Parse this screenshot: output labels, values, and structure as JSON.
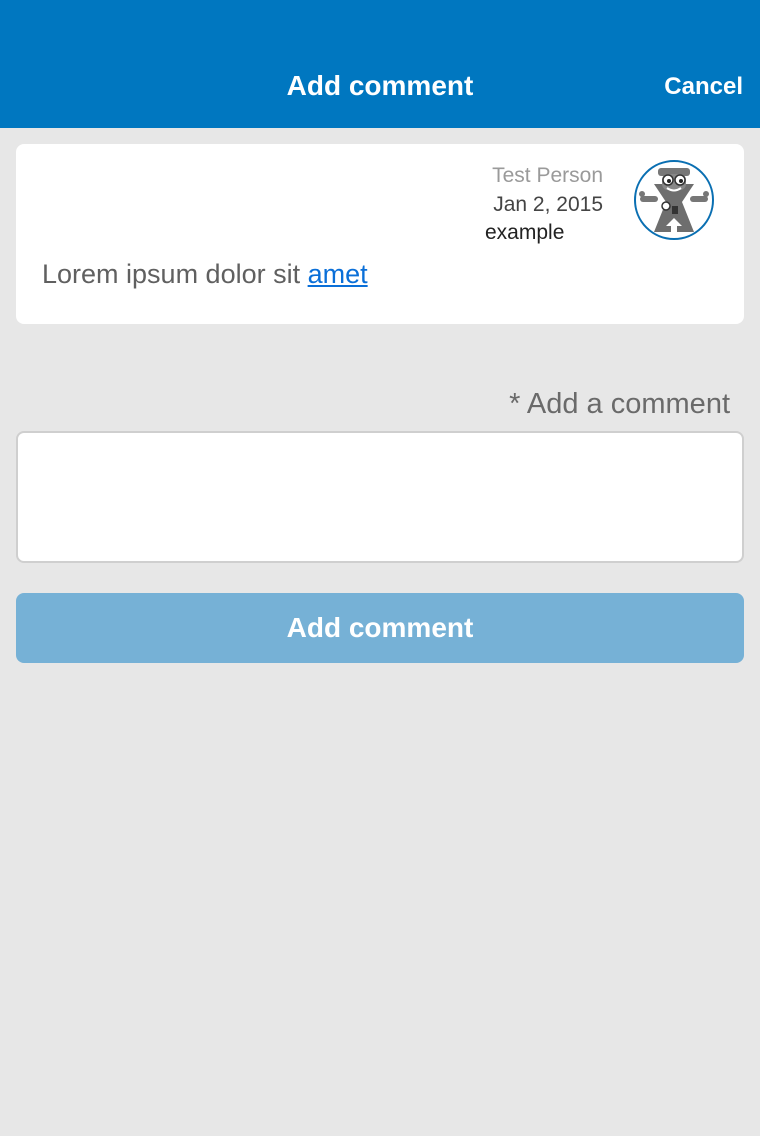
{
  "header": {
    "title": "Add comment",
    "cancel_label": "Cancel"
  },
  "comment": {
    "author": "Test Person",
    "date": "Jan 2, 2015",
    "tag": "example",
    "text_prefix": "Lorem ipsum dolor sit ",
    "link_text": "amet",
    "avatar_icon": "robot-mascot-icon"
  },
  "form": {
    "label": "* Add a comment",
    "textarea_value": "",
    "submit_label": "Add comment"
  },
  "colors": {
    "header_bg": "#0077c0",
    "background": "#e7e7e7",
    "link": "#0a6fd8",
    "button_disabled": "#76b1d6",
    "avatar_border": "#0a6fb2"
  }
}
